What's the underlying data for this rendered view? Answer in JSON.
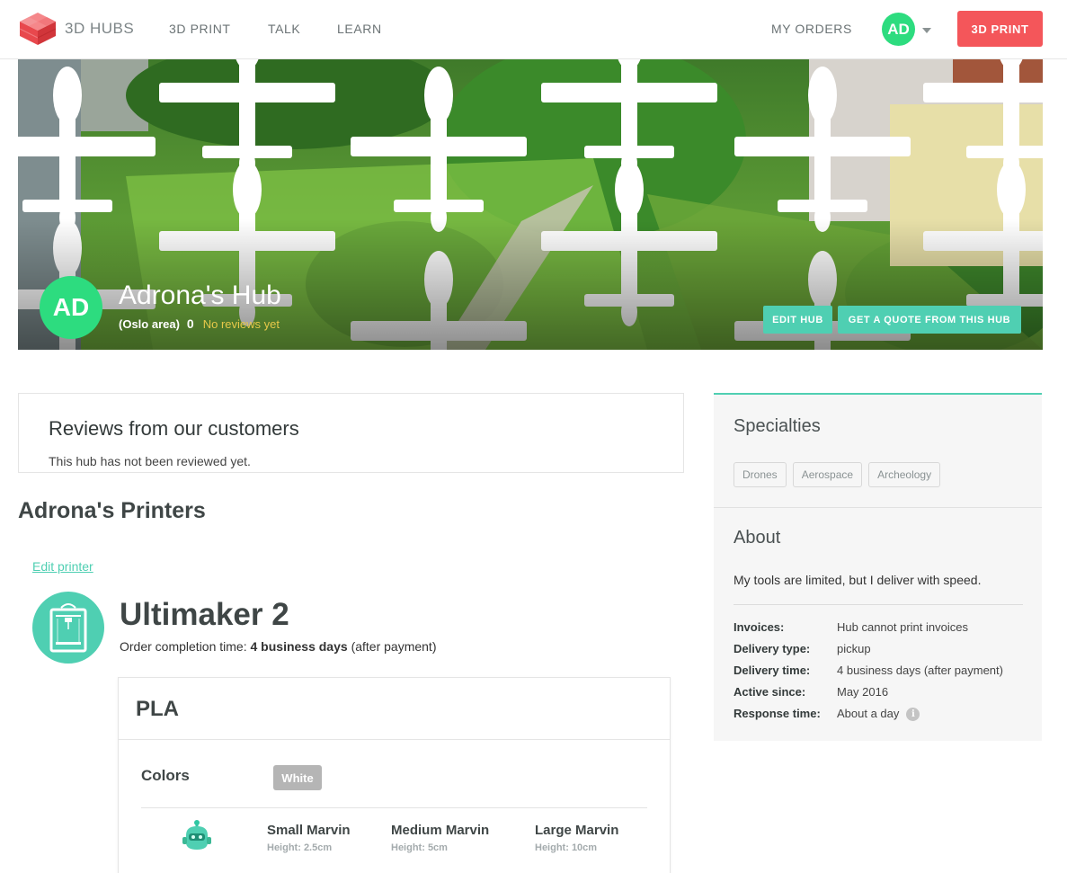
{
  "header": {
    "logo_text": "3D HUBS",
    "nav": [
      "3D PRINT",
      "TALK",
      "LEARN"
    ],
    "my_orders": "MY ORDERS",
    "user_initials": "AD",
    "cta_label": "3D PRINT",
    "colors": {
      "accent": "#f4565a",
      "avatar": "#2ddc7f"
    }
  },
  "hero": {
    "initials": "AD",
    "title": "Adrona's Hub",
    "location": "(Oslo area)",
    "review_count": "0",
    "no_reviews": "No reviews yet",
    "edit_hub": "EDIT HUB",
    "get_quote": "GET A QUOTE FROM THIS HUB",
    "colors": {
      "button": "#4fcfb2",
      "no_reviews": "#e6c84a"
    }
  },
  "reviews": {
    "title": "Reviews from our customers",
    "empty_text": "This hub has not been reviewed yet."
  },
  "printers": {
    "section_title": "Adrona's Printers",
    "edit_link": "Edit printer",
    "items": [
      {
        "name": "Ultimaker 2",
        "time_label": "Order completion time:",
        "time_value": "4 business days",
        "time_note": "(after payment)",
        "icon": "printer-icon",
        "material": {
          "name": "PLA",
          "colors_label": "Colors",
          "colors": [
            "White"
          ],
          "sizes": [
            {
              "name": "Small Marvin",
              "height": "Height: 2.5cm"
            },
            {
              "name": "Medium Marvin",
              "height": "Height: 5cm"
            },
            {
              "name": "Large Marvin",
              "height": "Height: 10cm"
            }
          ]
        }
      }
    ]
  },
  "sidebar": {
    "specialties_title": "Specialties",
    "specialties": [
      "Drones",
      "Aerospace",
      "Archeology"
    ],
    "about_title": "About",
    "about_text": "My tools are limited, but I deliver with speed.",
    "info": [
      {
        "key": "Invoices:",
        "value": "Hub cannot print invoices"
      },
      {
        "key": "Delivery type:",
        "value": "pickup"
      },
      {
        "key": "Delivery time:",
        "value": "4 business days (after payment)"
      },
      {
        "key": "Active since:",
        "value": "May 2016"
      },
      {
        "key": "Response time:",
        "value": "About a day"
      }
    ],
    "info_icon": "info-icon"
  }
}
